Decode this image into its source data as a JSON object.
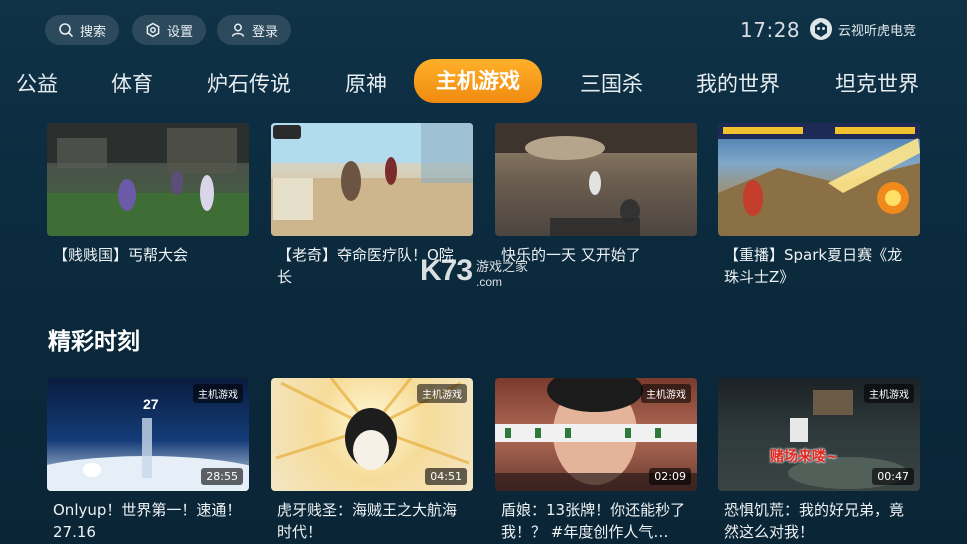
{
  "header": {
    "search_label": "搜索",
    "settings_label": "设置",
    "login_label": "登录",
    "time": "17:28",
    "brand": "云视听虎电竞"
  },
  "tabs": [
    {
      "label": "公益"
    },
    {
      "label": "体育"
    },
    {
      "label": "炉石传说"
    },
    {
      "label": "原神"
    },
    {
      "label": "主机游戏",
      "active": true
    },
    {
      "label": "三国杀"
    },
    {
      "label": "我的世界"
    },
    {
      "label": "坦克世界"
    }
  ],
  "top_row": [
    {
      "title": "【贱贱国】丐帮大会"
    },
    {
      "title": "【老奇】夺命医疗队！O院长"
    },
    {
      "title": "快乐的一天 又开始了"
    },
    {
      "title": "【重播】Spark夏日赛《龙珠斗士Z》"
    }
  ],
  "section_title": "精彩时刻",
  "highlights": [
    {
      "title": "Onlyup！世界第一！速通！27.16",
      "tag": "主机游戏",
      "duration": "28:55"
    },
    {
      "title": "虎牙贱圣：海贼王之大航海时代！",
      "tag": "主机游戏",
      "duration": "04:51"
    },
    {
      "title": "盾娘：13张牌！你还能秒了我！？ #年度创作人气…",
      "tag": "主机游戏",
      "duration": "02:09"
    },
    {
      "title": "恐惧饥荒：我的好兄弟，竟然这么对我！",
      "tag": "主机游戏",
      "duration": "00:47"
    }
  ],
  "watermark": {
    "main": "K73",
    "sub1": "游戏之家",
    "sub2": ".com"
  },
  "thumb_texts": {
    "onlyup_num": "27",
    "mahjong_caption": "赌场来喽~"
  },
  "colors": {
    "accent": "#f59a17",
    "background": "#0d2e42"
  }
}
